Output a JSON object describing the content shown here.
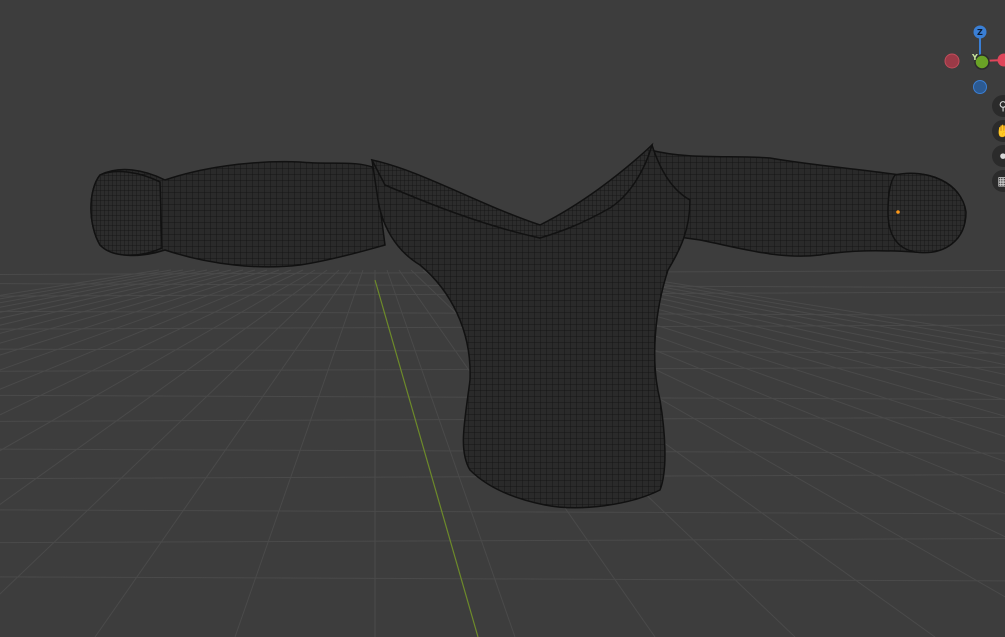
{
  "viewport": {
    "background": "#3d3d3d",
    "grid_color": "#4a4a4a",
    "y_axis_color": "#6d8a2a",
    "mesh_fill": "#252525",
    "mesh_wire": "#0d0d0d"
  },
  "gizmo": {
    "z_label": "Z",
    "y_label": "Y",
    "z_color": "#3a7fd5",
    "y_color": "#6aa326",
    "x_color": "#e0455a",
    "neg_x_color": "#9b3a47",
    "neg_z_color": "#2c5a92"
  },
  "nav_tools": [
    {
      "name": "zoom-icon",
      "glyph": "⚲"
    },
    {
      "name": "pan-hand-icon",
      "glyph": "✋"
    },
    {
      "name": "camera-icon",
      "glyph": "⏺"
    },
    {
      "name": "grid-view-icon",
      "glyph": "▦"
    }
  ]
}
